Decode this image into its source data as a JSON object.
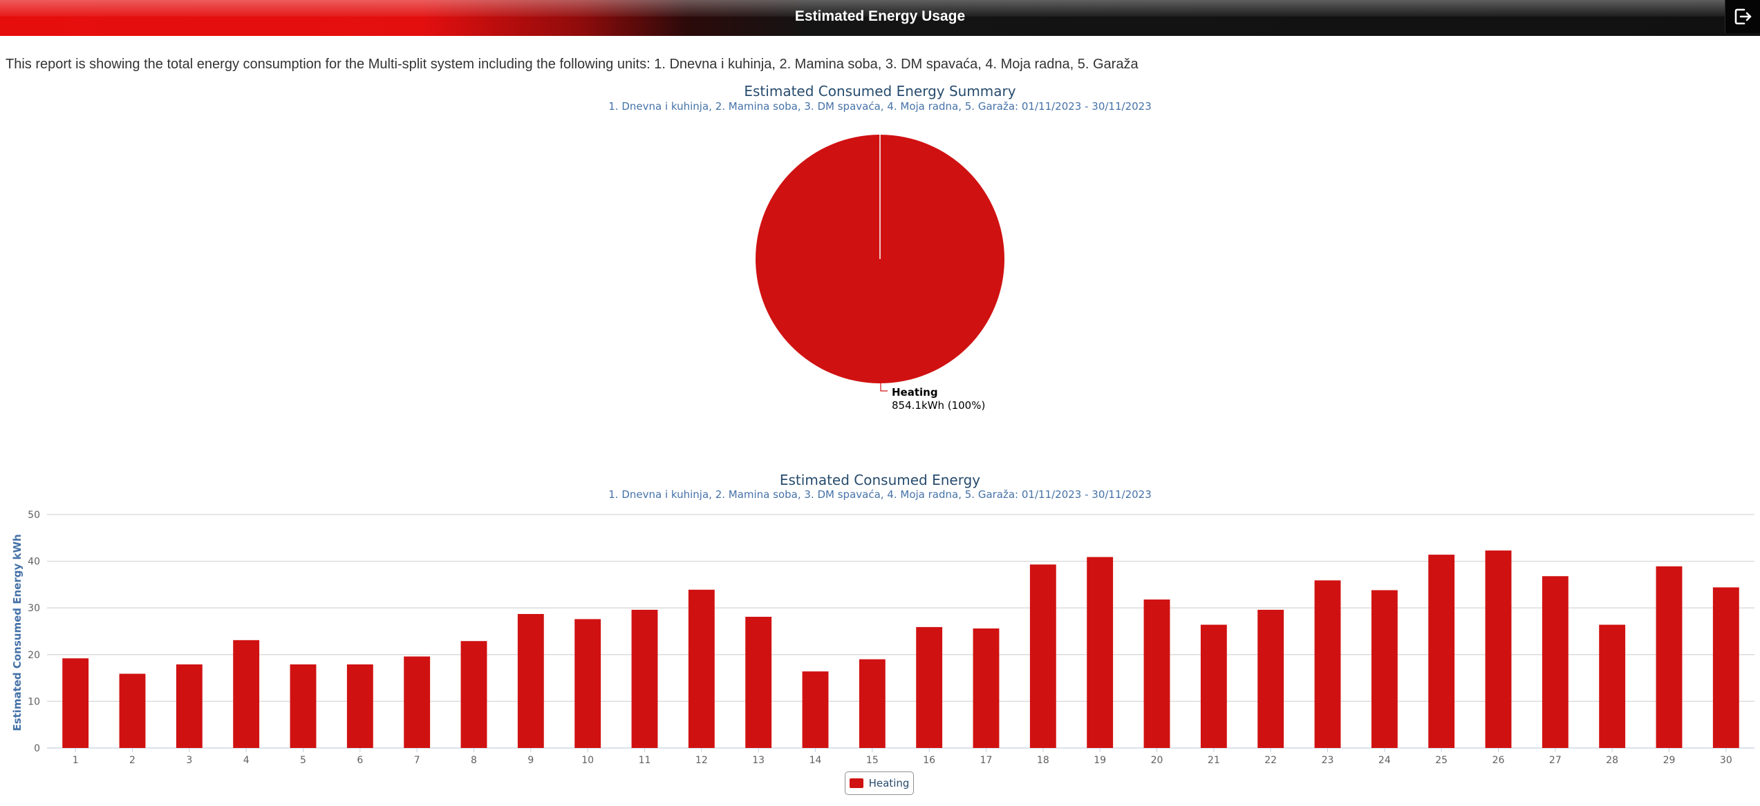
{
  "header": {
    "title": "Estimated Energy Usage",
    "logout_icon": "logout-icon"
  },
  "intro": {
    "text": "This report is showing the total energy consumption for the Multi-split system including the following units: 1. Dnevna i kuhinja, 2. Mamina soba, 3. DM spavaća, 4. Moja radna, 5. Garaža"
  },
  "colors": {
    "heating": "#d01111",
    "title": "#274b6d",
    "subtitle": "#4572a7"
  },
  "chart_data": [
    {
      "type": "pie",
      "title": "Estimated Consumed Energy Summary",
      "subtitle": "1. Dnevna i kuhinja, 2. Mamina soba, 3. DM spavaća, 4. Moja radna, 5. Garaža: 01/11/2023 - 30/11/2023",
      "slices": [
        {
          "name": "Heating",
          "value": 854.1,
          "unit": "kWh",
          "percent": 100,
          "value_label": "854.1kWh (100%)"
        }
      ]
    },
    {
      "type": "bar",
      "title": "Estimated Consumed Energy",
      "subtitle": "1. Dnevna i kuhinja, 2. Mamina soba, 3. DM spavaća, 4. Moja radna, 5. Garaža: 01/11/2023 - 30/11/2023",
      "ylabel": "Estimated Consumed Energy kWh",
      "ylim": [
        0,
        50
      ],
      "yticks": [
        0,
        10,
        20,
        30,
        40,
        50
      ],
      "grid": true,
      "legend": "bottom-center",
      "categories": [
        "1",
        "2",
        "3",
        "4",
        "5",
        "6",
        "7",
        "8",
        "9",
        "10",
        "11",
        "12",
        "13",
        "14",
        "15",
        "16",
        "17",
        "18",
        "19",
        "20",
        "21",
        "22",
        "23",
        "24",
        "25",
        "26",
        "27",
        "28",
        "29",
        "30"
      ],
      "series": [
        {
          "name": "Heating",
          "values": [
            19.2,
            15.9,
            17.9,
            23.1,
            17.9,
            17.9,
            19.6,
            22.9,
            28.7,
            27.6,
            29.6,
            33.9,
            28.1,
            16.4,
            19.0,
            25.9,
            25.6,
            39.3,
            40.9,
            31.8,
            26.4,
            29.6,
            35.9,
            33.8,
            41.4,
            42.3,
            36.8,
            26.4,
            38.9,
            34.4
          ]
        }
      ]
    }
  ]
}
